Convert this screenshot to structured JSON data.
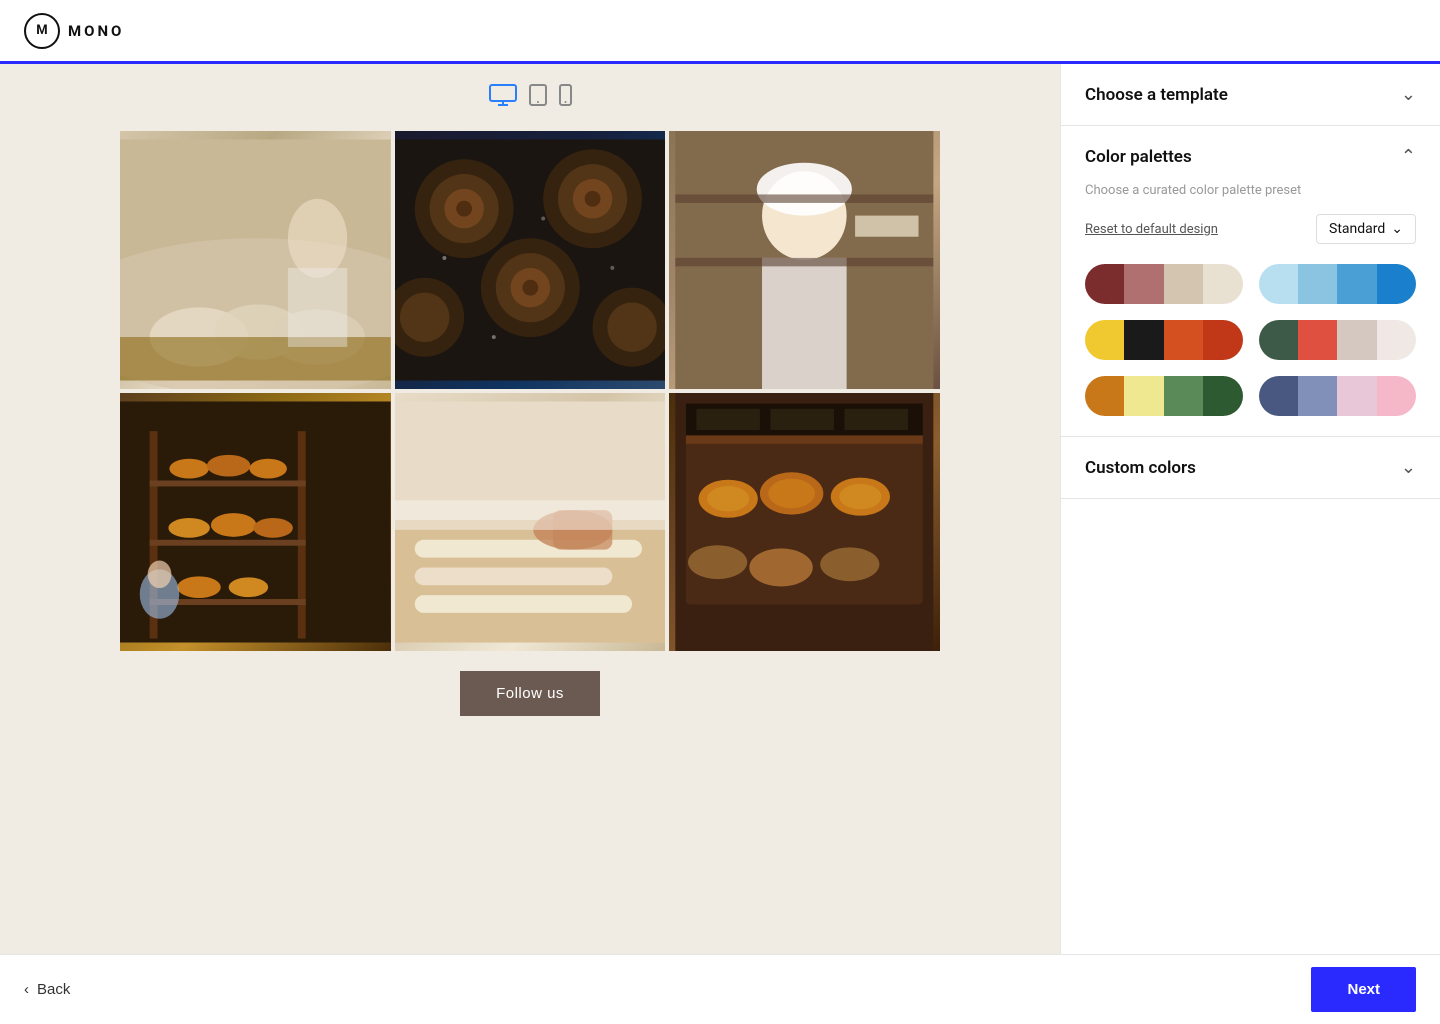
{
  "header": {
    "logo_letter": "M",
    "logo_text": "MONO"
  },
  "progress_bar": {
    "color": "#2a2aff",
    "width_percent": 40
  },
  "device_icons": [
    {
      "name": "desktop",
      "active": true
    },
    {
      "name": "tablet",
      "active": false
    },
    {
      "name": "mobile",
      "active": false
    }
  ],
  "preview": {
    "follow_button_label": "Follow us",
    "background_color": "#f0ebe3",
    "photos": [
      {
        "id": 1,
        "alt": "Baker working with bread dough",
        "css_class": "photo-1"
      },
      {
        "id": 2,
        "alt": "Cinnamon rolls from above",
        "css_class": "photo-2"
      },
      {
        "id": 3,
        "alt": "Baker woman in white uniform",
        "css_class": "photo-3"
      },
      {
        "id": 4,
        "alt": "Bakery shelves with bread",
        "css_class": "photo-4"
      },
      {
        "id": 5,
        "alt": "Hands shaping bread dough",
        "css_class": "photo-5"
      },
      {
        "id": 6,
        "alt": "Bread loaves on display",
        "css_class": "photo-6"
      }
    ]
  },
  "right_panel": {
    "sections": [
      {
        "id": "choose-template",
        "title": "Choose a template",
        "expanded": false,
        "chevron": "chevron-down"
      },
      {
        "id": "color-palettes",
        "title": "Color palettes",
        "expanded": true,
        "chevron": "chevron-up",
        "subtitle": "Choose a curated color palette preset",
        "reset_label": "Reset to default design",
        "dropdown_label": "Standard",
        "palettes": [
          {
            "id": "palette-1",
            "swatches": [
              "#7b2d2d",
              "#b07070",
              "#d4c5b0",
              "#e8e0d0"
            ]
          },
          {
            "id": "palette-2",
            "swatches": [
              "#b8dff0",
              "#8ac4e0",
              "#4a9fd4",
              "#1a7fcc"
            ]
          },
          {
            "id": "palette-3",
            "swatches": [
              "#f0c830",
              "#1a1a1a",
              "#d45020",
              "#c03818"
            ]
          },
          {
            "id": "palette-4",
            "swatches": [
              "#3d5a48",
              "#e05040",
              "#d4c8c0",
              "#f0e8e4"
            ]
          },
          {
            "id": "palette-5",
            "swatches": [
              "#c87818",
              "#f0e890",
              "#5a8a58",
              "#2d5a30"
            ]
          },
          {
            "id": "palette-6",
            "swatches": [
              "#485880",
              "#8090b8",
              "#e8c8d8",
              "#f4b8c8"
            ]
          }
        ]
      },
      {
        "id": "custom-colors",
        "title": "Custom colors",
        "expanded": false,
        "chevron": "chevron-down"
      }
    ]
  },
  "footer": {
    "back_label": "Back",
    "next_label": "Next",
    "back_icon": "‹"
  }
}
